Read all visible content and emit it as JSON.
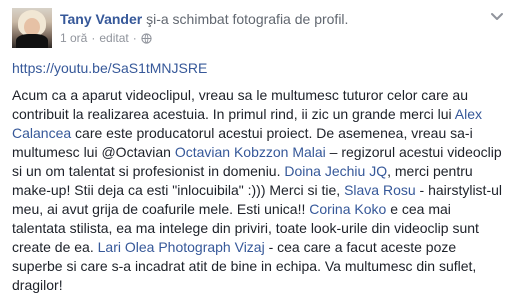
{
  "post": {
    "author": "Tany Vander",
    "action": " şi-a schimbat fotografia de profil.",
    "time": "1 oră",
    "edited": "editat",
    "separator": "·",
    "link": "https://youtu.be/SaS1tMNJSRE"
  },
  "body": {
    "t1": "Acum ca a aparut videoclipul, vreau sa le multumesc tuturor celor care au contribuit la realizarea acestuia. In primul rind, ii zic un grande merci lui ",
    "m1": "Alex Calancea",
    "t2": " care este producatorul acestui proiect. De asemenea, vreau sa-i multumesc lui @Octavian ",
    "m2": "Octavian Kobzzon Malai",
    "t3": " – regizorul acestui videoclip si un om talentat si profesionist in domeniu. ",
    "m3": "Doina Jechiu JQ",
    "t4": ", merci pentru make-up! Stii deja ca esti \"inlocuibila\" :))) Merci si tie, ",
    "m4": "Slava Rosu",
    "t5": " - hairstylist-ul meu, ai avut grija de coafurile mele. Esti unica!! ",
    "m5": "Corina Koko",
    "t6": " e cea mai talentata stilista, ea ma intelege din priviri, toate look-urile din videoclip sunt create de ea. ",
    "m6": "Lari Olea Photograph Vizaj",
    "t7": " - cea care a facut aceste poze superbe si care s-a incadrat atit de bine in echipa. Va multumesc din suflet, dragilor!"
  },
  "icons": {
    "avatar": "profile-photo",
    "globe": "globe-icon",
    "menu": "chevron-down-icon"
  },
  "colors": {
    "link": "#365899",
    "text": "#1d2129",
    "muted": "#90949c"
  }
}
